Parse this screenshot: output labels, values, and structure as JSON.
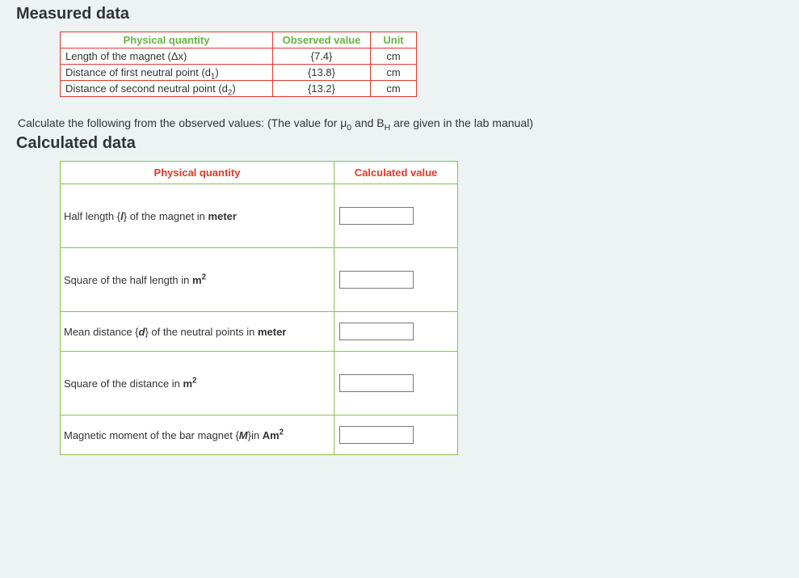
{
  "measured": {
    "title": "Measured data",
    "headers": {
      "qty": "Physical quantity",
      "val": "Observed value",
      "unit": "Unit"
    },
    "rows": [
      {
        "qty_pre": "Length of the magnet (",
        "qty_sym": "Δx",
        "qty_post": ")",
        "val": "{7.4}",
        "unit": "cm"
      },
      {
        "qty_pre": "Distance of first neutral point (d",
        "qty_sub": "1",
        "qty_post": ")",
        "val": "{13.8}",
        "unit": "cm"
      },
      {
        "qty_pre": "Distance of second neutral point (d",
        "qty_sub": "2",
        "qty_post": ")",
        "val": "{13.2}",
        "unit": "cm"
      }
    ]
  },
  "instruction": {
    "pre": "Calculate the following from the observed values: (The value for ",
    "mu": "μ",
    "mu_sub": "0",
    "mid": " and B",
    "b_sub": "H",
    "post": " are given in the lab manual)"
  },
  "calculated": {
    "title": "Calculated data",
    "headers": {
      "qty": "Physical quantity",
      "val": "Calculated value"
    },
    "rows": [
      {
        "pre": "Half length {",
        "sym_i": "l",
        "post1": "} of the magnet in ",
        "unit_b": "meter"
      },
      {
        "pre": "Square of the half length in ",
        "unit_b": "m",
        "unit_sup": "2"
      },
      {
        "pre": "Mean distance {",
        "sym_bi": "d",
        "post1": "} of the neutral points in ",
        "unit_b": "meter"
      },
      {
        "pre": "Square of the distance in ",
        "unit_b": "m",
        "unit_sup": "2"
      },
      {
        "pre": "Magnetic moment of the bar magnet {",
        "sym_bi": "M",
        "post1": "}in ",
        "unit_b": "Am",
        "unit_sup": "2"
      }
    ]
  }
}
